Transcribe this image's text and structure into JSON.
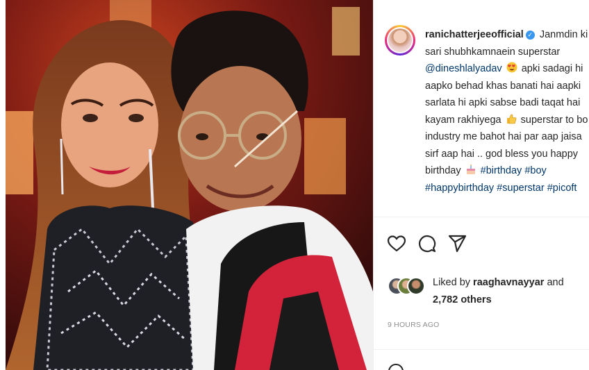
{
  "post": {
    "username": "ranichatterjeeofficial",
    "caption_lines": [
      {
        "pre": "",
        "text": " Janmdin ki"
      },
      {
        "text": "sari shubhkamnaein superstar"
      },
      {
        "mention": "@dineshlalyadav",
        "after": " apki sadagi hi"
      },
      {
        "text": "aapko behad khas banati hai aapki"
      },
      {
        "text": "sarlata hi apki sabse badi taqat hai"
      },
      {
        "text": "kayam rakhiyega",
        "after": " superstar to bo"
      },
      {
        "text": "industry me bahot hai par aap jaisa"
      },
      {
        "text": "sirf aap hai .. god bless you happy"
      },
      {
        "text": "birthday",
        "tags": " #birthday #boy"
      },
      {
        "tags": "#happybirthday #superstar #picoft"
      }
    ],
    "verified_mark": "✓",
    "likes": {
      "prefix": "Liked by ",
      "user": "raaghavnayyar",
      "and": " and",
      "others": "2,782 others"
    },
    "timestamp": "9 HOURS AGO"
  },
  "icons": {
    "like": "heart-icon",
    "comment": "comment-icon",
    "share": "share-icon",
    "verified": "verified-badge-icon",
    "emoji_heart_eyes": "heart-eyes-emoji-icon",
    "emoji_thumbs_up": "thumbs-up-emoji-icon",
    "emoji_cake": "birthday-cake-emoji-icon"
  },
  "colors": {
    "text": "#262626",
    "link": "#00376b",
    "muted": "#8e8e8e",
    "verified": "#3897f0",
    "divider": "#efefef"
  }
}
